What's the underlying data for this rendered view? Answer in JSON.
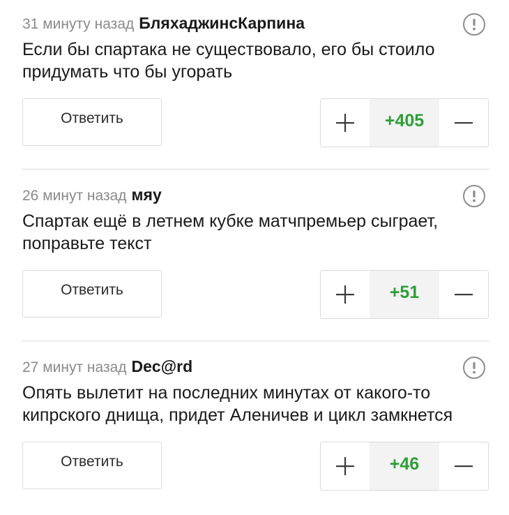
{
  "comments": [
    {
      "time": "31 минуту назад",
      "author": "БляхаджинсКарпина",
      "text": "Если бы спартака не существовало, его бы стоило придумать что бы угорать",
      "reply_label": "Ответить",
      "score": "+405"
    },
    {
      "time": "26 минут назад",
      "author": "мяу",
      "text": "Спартак ещё в летнем кубке матчпремьер сыграет, поправьте текст",
      "reply_label": "Ответить",
      "score": "+51"
    },
    {
      "time": "27 минут назад",
      "author": "Dec@rd",
      "text": "Опять вылетит на последних минутах от какого-то кипрского днища, придет Аленичев и цикл замкнется",
      "reply_label": "Ответить",
      "score": "+46"
    }
  ],
  "icons": {
    "report": "exclamation-circle-icon",
    "upvote": "plus-icon",
    "downvote": "minus-icon"
  },
  "colors": {
    "score_positive": "#2e9e38",
    "meta_time": "#8a8a8a",
    "border": "#dadada"
  }
}
